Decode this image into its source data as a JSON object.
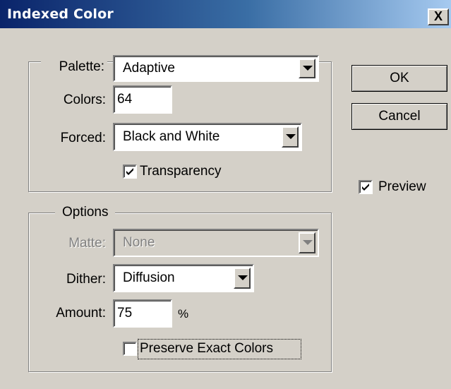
{
  "window": {
    "title": "Indexed Color",
    "close_label": "X"
  },
  "palette_group": {
    "palette": {
      "label": "Palette:",
      "value": "Adaptive"
    },
    "colors": {
      "label": "Colors:",
      "value": "64"
    },
    "forced": {
      "label": "Forced:",
      "value": "Black and White"
    },
    "transparency": {
      "label": "Transparency",
      "checked": true
    }
  },
  "options_group": {
    "legend": "Options",
    "matte": {
      "label": "Matte:",
      "value": "None",
      "enabled": false
    },
    "dither": {
      "label": "Dither:",
      "value": "Diffusion"
    },
    "amount": {
      "label": "Amount:",
      "value": "75",
      "unit": "%"
    },
    "preserve_exact_colors": {
      "label": "Preserve Exact Colors",
      "checked": false
    }
  },
  "buttons": {
    "ok": "OK",
    "cancel": "Cancel"
  },
  "preview": {
    "label": "Preview",
    "checked": true
  },
  "colors": {
    "dialog_bg": "#d4d0c8",
    "title_start": "#0a246a",
    "title_end": "#a6caf0"
  }
}
